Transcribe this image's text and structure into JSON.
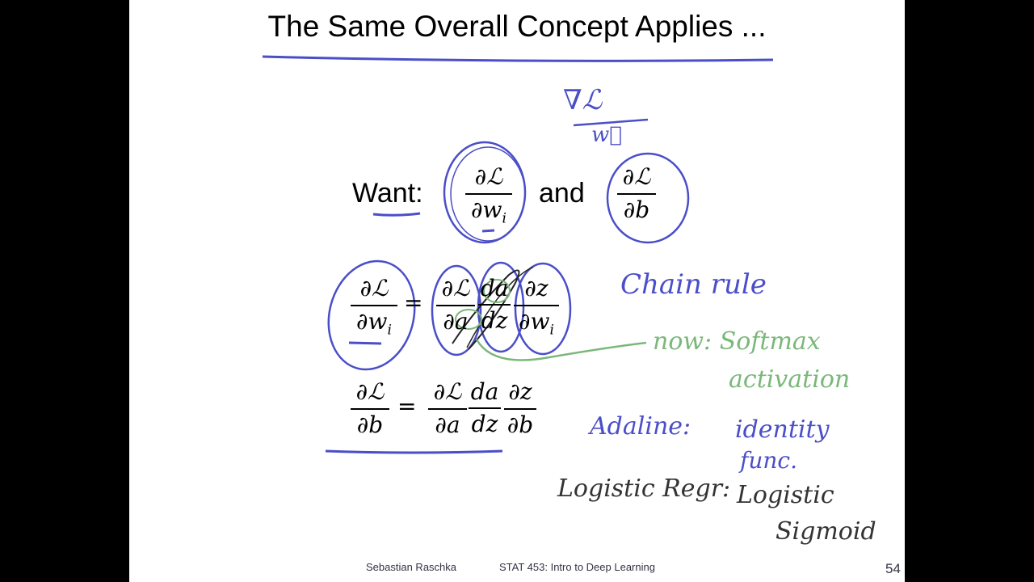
{
  "slide": {
    "title": "The Same Overall Concept Applies ...",
    "want_label": "Want:",
    "and_label": "and",
    "equals": "=",
    "partial": "∂",
    "loss": "ℒ",
    "w": "w",
    "i": "i",
    "a": "a",
    "z": "z",
    "b": "b",
    "da": "da",
    "dz": "dz",
    "footer_author": "Sebastian Raschka",
    "footer_course": "STAT 453: Intro to Deep Learning",
    "page_number": "54"
  },
  "annotations": {
    "grad_symbol": "∇ℒ",
    "grad_vector": "w⃗",
    "chain_rule": "Chain rule",
    "now_softmax": "now: Softmax",
    "activation": "activation",
    "adaline": "Adaline:",
    "identity": "identity",
    "func": "func.",
    "logistic_regr": "Logistic Regr:",
    "logistic": "Logistic",
    "sigmoid": "Sigmoid",
    "colors": {
      "blue_ink": "#4a4ec8",
      "green_ink": "#7ab87a",
      "dark_ink": "#333333"
    }
  }
}
